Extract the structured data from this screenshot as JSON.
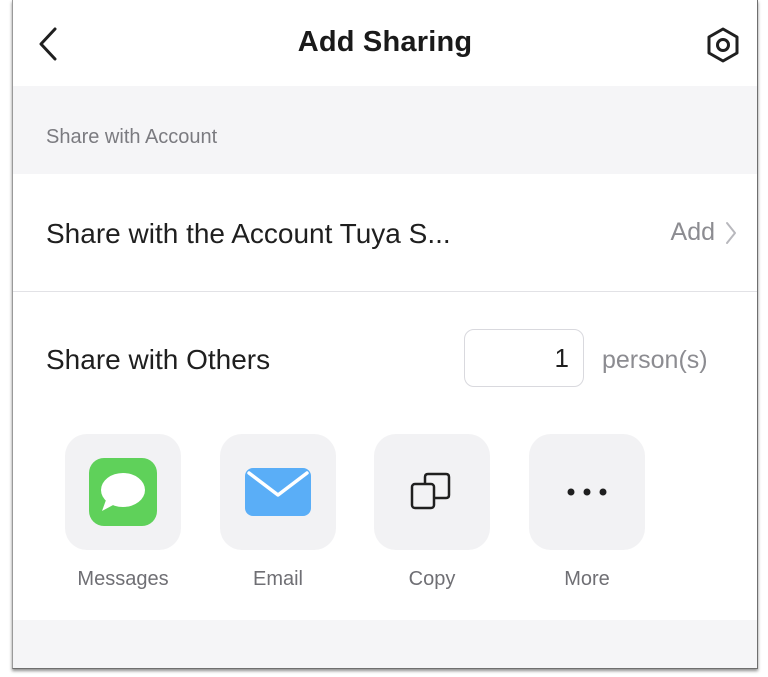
{
  "header": {
    "title": "Add Sharing",
    "back_icon": "chevron-left-icon",
    "settings_icon": "settings-hexagon-icon"
  },
  "account_section": {
    "header": "Share with Account",
    "row_label": "Share with the Account Tuya S...",
    "action_label": "Add",
    "action_icon": "chevron-right-icon"
  },
  "others_section": {
    "label": "Share with Others",
    "count_value": "1",
    "count_unit": "person(s)",
    "options": [
      {
        "label": "Messages",
        "icon": "messages-icon",
        "color": "#5fd15a"
      },
      {
        "label": "Email",
        "icon": "email-icon",
        "color": "#5aaef7"
      },
      {
        "label": "Copy",
        "icon": "copy-icon",
        "color": "#1f1f1f"
      },
      {
        "label": "More",
        "icon": "more-icon",
        "color": "#1f1f1f"
      }
    ]
  },
  "colors": {
    "background": "#f5f5f7",
    "card": "#ffffff",
    "secondary_text": "#8c8c91"
  }
}
